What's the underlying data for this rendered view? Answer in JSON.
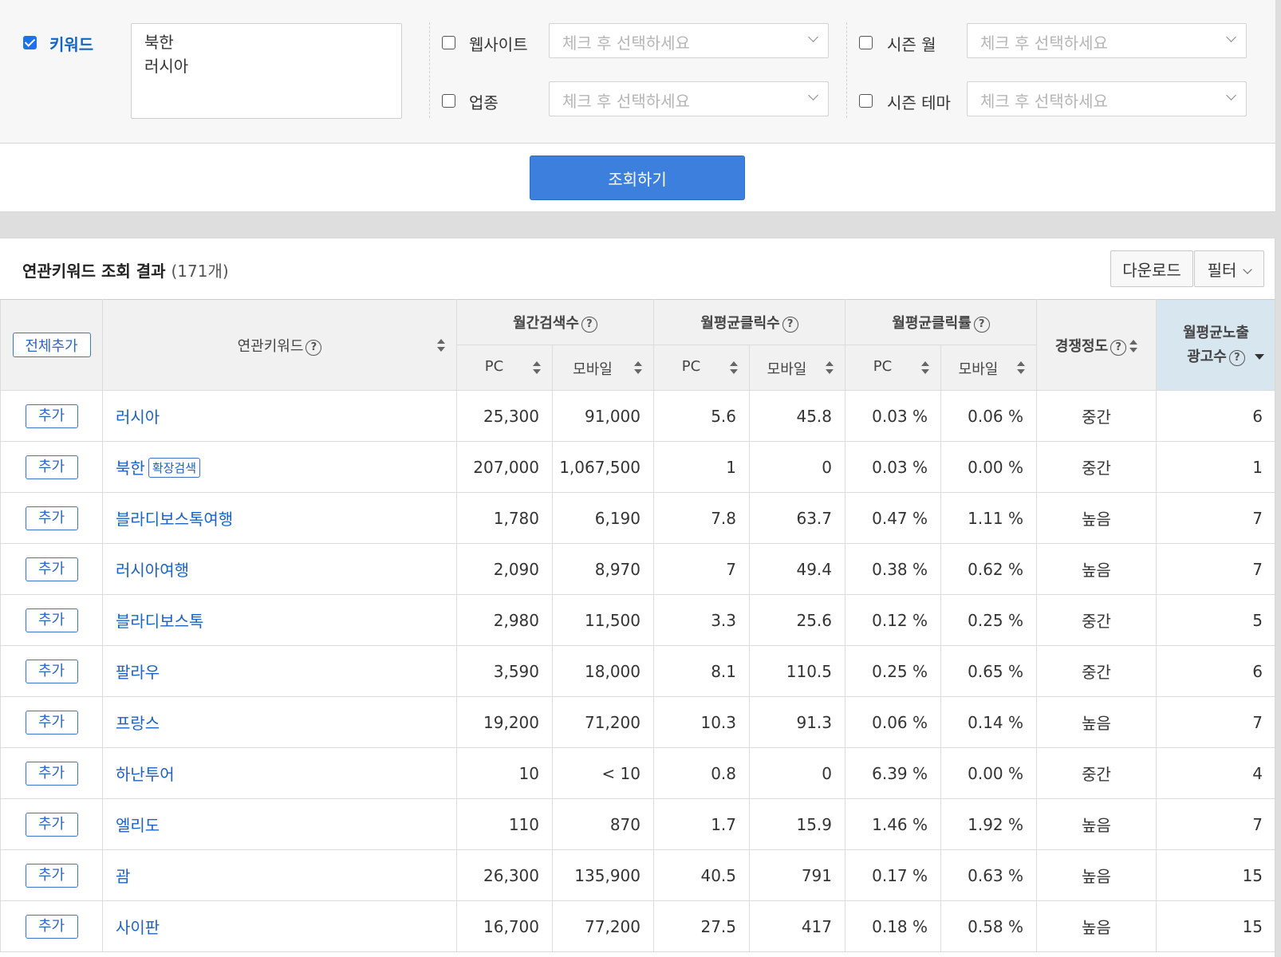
{
  "filters": {
    "keyword": {
      "label": "키워드",
      "checked": true,
      "values": [
        "북한",
        "러시아"
      ]
    },
    "website": {
      "label": "웹사이트",
      "checked": false,
      "placeholder": "체크 후 선택하세요"
    },
    "industry": {
      "label": "업종",
      "checked": false,
      "placeholder": "체크 후 선택하세요"
    },
    "season_month": {
      "label": "시즌 월",
      "checked": false,
      "placeholder": "체크 후 선택하세요"
    },
    "season_theme": {
      "label": "시즌 테마",
      "checked": false,
      "placeholder": "체크 후 선택하세요"
    }
  },
  "search_button": "조회하기",
  "results": {
    "title": "연관키워드 조회 결과",
    "count": "(171개)",
    "download_button": "다운로드",
    "filter_button": "필터"
  },
  "table": {
    "add_all": "전체추가",
    "headers": {
      "keyword": "연관키워드",
      "monthly_search": "월간검색수",
      "avg_clicks": "월평균클릭수",
      "avg_ctr": "월평균클릭률",
      "competition": "경쟁정도",
      "ad_count_line1": "월평균노출",
      "ad_count_line2": "광고수",
      "pc": "PC",
      "mobile": "모바일"
    },
    "add_label": "추가",
    "badge_label": "확장검색",
    "rows": [
      {
        "keyword": "러시아",
        "badge": false,
        "search_pc": "25,300",
        "search_mobile": "91,000",
        "click_pc": "5.6",
        "click_mobile": "45.8",
        "ctr_pc": "0.03 %",
        "ctr_mobile": "0.06 %",
        "competition": "중간",
        "ads": "6"
      },
      {
        "keyword": "북한",
        "badge": true,
        "search_pc": "207,000",
        "search_mobile": "1,067,500",
        "click_pc": "1",
        "click_mobile": "0",
        "ctr_pc": "0.03 %",
        "ctr_mobile": "0.00 %",
        "competition": "중간",
        "ads": "1"
      },
      {
        "keyword": "블라디보스톡여행",
        "badge": false,
        "search_pc": "1,780",
        "search_mobile": "6,190",
        "click_pc": "7.8",
        "click_mobile": "63.7",
        "ctr_pc": "0.47 %",
        "ctr_mobile": "1.11 %",
        "competition": "높음",
        "ads": "7"
      },
      {
        "keyword": "러시아여행",
        "badge": false,
        "search_pc": "2,090",
        "search_mobile": "8,970",
        "click_pc": "7",
        "click_mobile": "49.4",
        "ctr_pc": "0.38 %",
        "ctr_mobile": "0.62 %",
        "competition": "높음",
        "ads": "7"
      },
      {
        "keyword": "블라디보스톡",
        "badge": false,
        "search_pc": "2,980",
        "search_mobile": "11,500",
        "click_pc": "3.3",
        "click_mobile": "25.6",
        "ctr_pc": "0.12 %",
        "ctr_mobile": "0.25 %",
        "competition": "중간",
        "ads": "5"
      },
      {
        "keyword": "팔라우",
        "badge": false,
        "search_pc": "3,590",
        "search_mobile": "18,000",
        "click_pc": "8.1",
        "click_mobile": "110.5",
        "ctr_pc": "0.25 %",
        "ctr_mobile": "0.65 %",
        "competition": "중간",
        "ads": "6"
      },
      {
        "keyword": "프랑스",
        "badge": false,
        "search_pc": "19,200",
        "search_mobile": "71,200",
        "click_pc": "10.3",
        "click_mobile": "91.3",
        "ctr_pc": "0.06 %",
        "ctr_mobile": "0.14 %",
        "competition": "높음",
        "ads": "7"
      },
      {
        "keyword": "하난투어",
        "badge": false,
        "search_pc": "10",
        "search_mobile": "< 10",
        "click_pc": "0.8",
        "click_mobile": "0",
        "ctr_pc": "6.39 %",
        "ctr_mobile": "0.00 %",
        "competition": "중간",
        "ads": "4"
      },
      {
        "keyword": "엘리도",
        "badge": false,
        "search_pc": "110",
        "search_mobile": "870",
        "click_pc": "1.7",
        "click_mobile": "15.9",
        "ctr_pc": "1.46 %",
        "ctr_mobile": "1.92 %",
        "competition": "높음",
        "ads": "7"
      },
      {
        "keyword": "괌",
        "badge": false,
        "search_pc": "26,300",
        "search_mobile": "135,900",
        "click_pc": "40.5",
        "click_mobile": "791",
        "ctr_pc": "0.17 %",
        "ctr_mobile": "0.63 %",
        "competition": "높음",
        "ads": "15"
      },
      {
        "keyword": "사이판",
        "badge": false,
        "search_pc": "16,700",
        "search_mobile": "77,200",
        "click_pc": "27.5",
        "click_mobile": "417",
        "ctr_pc": "0.18 %",
        "ctr_mobile": "0.58 %",
        "competition": "높음",
        "ads": "15"
      }
    ]
  },
  "colors": {
    "accent": "#3d7fdd",
    "link": "#1a62c4",
    "sorted_header": "#d8e6f0"
  }
}
